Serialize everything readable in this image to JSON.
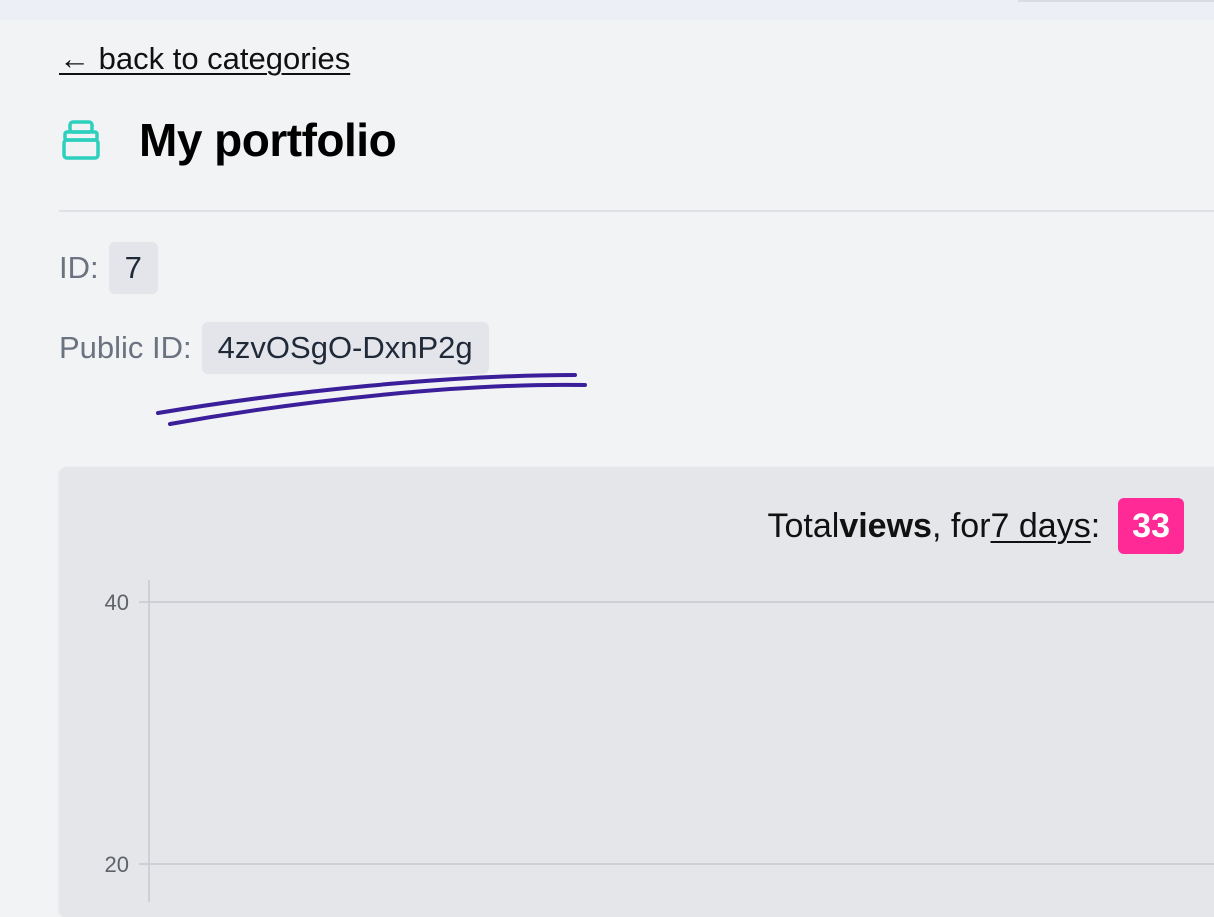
{
  "nav": {
    "back_label": "← back to categories"
  },
  "header": {
    "icon": "category-box-icon",
    "title": "My portfolio",
    "accent_color": "#2dcfbd"
  },
  "meta": {
    "id_label": "ID:",
    "id_value": "7",
    "public_id_label": "Public ID:",
    "public_id_value": "4zvOSgO-DxnP2g"
  },
  "stats": {
    "prefix": "Total ",
    "metric": "views",
    "middle": ", for ",
    "period_link": "7 days",
    "suffix": ":",
    "total": "33",
    "badge_color": "#ff2a96"
  },
  "chart_data": {
    "type": "line",
    "y_ticks": [
      "40",
      "20"
    ],
    "ylim": [
      0,
      40
    ],
    "grid": true
  }
}
